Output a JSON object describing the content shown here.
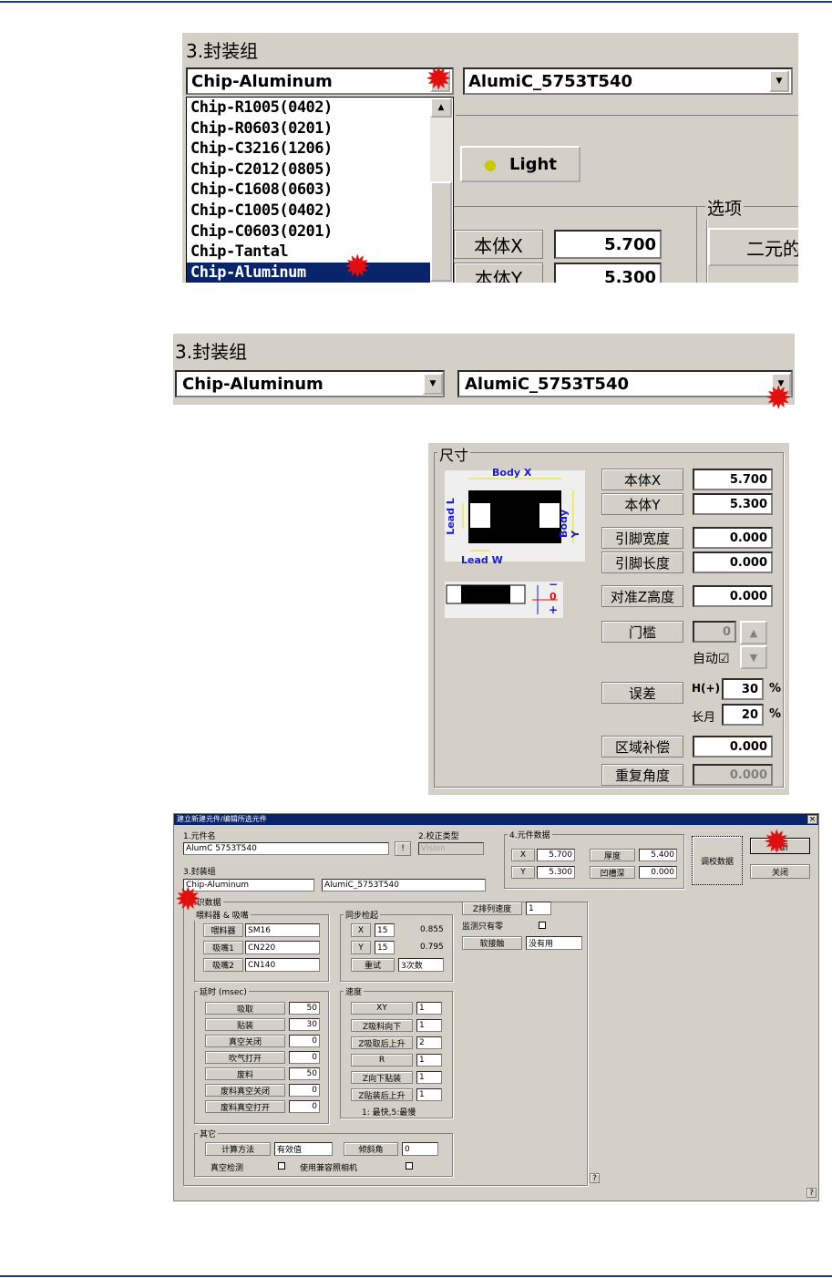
{
  "panel1": {
    "group_title": "3.封装组",
    "combo_left": "Chip-Aluminum",
    "combo_right": "AlumiC_5753T540",
    "list_items": [
      "Chip-R1005(0402)",
      "Chip-R0603(0201)",
      "Chip-C3216(1206)",
      "Chip-C2012(0805)",
      "Chip-C1608(0603)",
      "Chip-C1005(0402)",
      "Chip-C0603(0201)",
      "Chip-Tantal",
      "Chip-Aluminum"
    ],
    "light_button": "Light",
    "options_title": "选项",
    "option_button": "二元的",
    "body_x_label": "本体X",
    "body_x_value": "5.700",
    "body_y_label": "本体Y",
    "body_y_value": "5.300"
  },
  "panel2": {
    "group_title": "3.封装组",
    "combo_left": "Chip-Aluminum",
    "combo_right": "AlumiC_5753T540"
  },
  "panel3": {
    "group_title": "尺寸",
    "diagram": {
      "body_x": "Body X",
      "body_y": "Body Y",
      "lead_l": "Lead L",
      "lead_w": "Lead W",
      "minus": "−",
      "zero": "0",
      "plus": "+"
    },
    "rows": {
      "body_x": {
        "label": "本体X",
        "value": "5.700"
      },
      "body_y": {
        "label": "本体Y",
        "value": "5.300"
      },
      "lead_w": {
        "label": "引脚宽度",
        "value": "0.000"
      },
      "lead_l": {
        "label": "引脚长度",
        "value": "0.000"
      },
      "z_height": {
        "label": "对准Z高度",
        "value": "0.000"
      },
      "threshold": {
        "label": "门槛",
        "value": "0"
      },
      "auto": "自动☑",
      "tolerance": {
        "label": "误差",
        "h_label": "H(+)",
        "h_value": "30",
        "l_label": "长月",
        "l_value": "20",
        "unit": "%"
      },
      "area": {
        "label": "区域补偿",
        "value": "0.000"
      },
      "angle": {
        "label": "重复角度",
        "value": "0.000"
      }
    }
  },
  "dialog": {
    "title": "建立新建元件/编辑所选元件",
    "close": "×",
    "name_label": "1.元件名",
    "name_value": "AlumC 5753T540",
    "bang": "!",
    "calib_label": "2.校正类型",
    "calib_value": "Vision",
    "package_label": "3.封装组",
    "package_left": "Chip-Aluminum",
    "package_right": "AlumiC_5753T540",
    "data_title": "4.元件数据",
    "data": {
      "x_label": "X",
      "x": "5.700",
      "y_label": "Y",
      "y": "5.300",
      "thick_label": "厚度",
      "thick": "5.400",
      "groove_label": "凹槽深",
      "groove": "0.000"
    },
    "calib_button": "调校数据",
    "register_button": "注册",
    "close_button": "关闭",
    "tab_title": "6.识数据",
    "feeder_title": "喂料器 & 吸嘴",
    "feeder": [
      {
        "label": "喂料器",
        "value": "SM16"
      },
      {
        "label": "吸嘴1",
        "value": "CN220"
      },
      {
        "label": "吸嘴2",
        "value": "CN140"
      }
    ],
    "sync_title": "同步检起",
    "sync": {
      "x_label": "X",
      "x": "15",
      "x_res": "0.855",
      "y_label": "Y",
      "y": "15",
      "y_res": "0.795",
      "retry_label": "重试",
      "retry_value": "3次数"
    },
    "zsort_label": "Z排列速度",
    "zsort_value": "1",
    "monitor_label": "监测只有零",
    "software_label": "软接触",
    "software_value": "没有用",
    "delay_title": "延时 (msec)",
    "delay": [
      {
        "label": "吸取",
        "value": "50"
      },
      {
        "label": "贴装",
        "value": "30"
      },
      {
        "label": "真空关闭",
        "value": "0"
      },
      {
        "label": "吹气打开",
        "value": "0"
      },
      {
        "label": "废料",
        "value": "50"
      },
      {
        "label": "废料真空关闭",
        "value": "0"
      },
      {
        "label": "废料真空打开",
        "value": "0"
      }
    ],
    "speed_title": "速度",
    "speed": [
      {
        "label": "XY",
        "value": "1"
      },
      {
        "label": "Z吸料向下",
        "value": "1"
      },
      {
        "label": "Z吸取后上升",
        "value": "2"
      },
      {
        "label": "R",
        "value": "1"
      },
      {
        "label": "Z向下贴装",
        "value": "1"
      },
      {
        "label": "Z贴装后上升",
        "value": "1"
      }
    ],
    "speed_note": "1: 最快,5:最慢",
    "other_title": "其它",
    "calc_label": "计算方法",
    "calc_value": "有效值",
    "tilt_label": "倾斜角",
    "tilt_value": "0",
    "vacuum_label": "真空检测",
    "camera_label": "使用兼容照相机",
    "help": "?"
  },
  "colors": {
    "accent_red": "#e01010",
    "title_bar": "#0a246a",
    "dialog_bg": "#d4d0c8",
    "rule": "#1d3b8c"
  }
}
